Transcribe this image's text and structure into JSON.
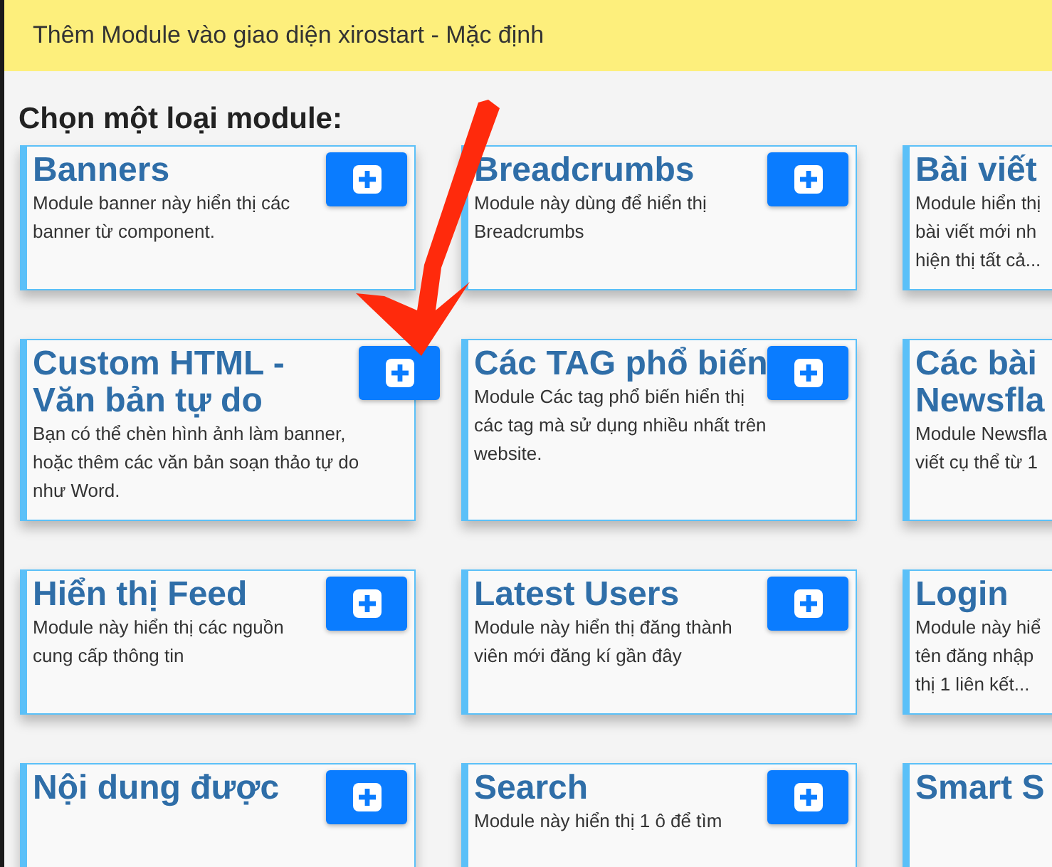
{
  "window": {
    "title": "Thêm Module vào giao diện xirostart - Mặc định"
  },
  "heading": "Chọn một loại module:",
  "modules": [
    {
      "title": [
        "Banners"
      ],
      "description": [
        "Module banner này hiển thị các",
        "banner từ component."
      ]
    },
    {
      "title": [
        "Breadcrumbs"
      ],
      "description": [
        "Module này dùng để hiển thị",
        "Breadcrumbs"
      ]
    },
    {
      "title": [
        "Bài viết"
      ],
      "description": [
        "Module hiển thị",
        "bài viết mới nh",
        "hiện thị tất cả..."
      ]
    },
    {
      "title": [
        "Custom HTML -",
        "Văn bản tự do"
      ],
      "description": [
        "Bạn có thể chèn hình ảnh làm banner,",
        "hoặc thêm các văn bản soạn thảo tự do",
        "như Word."
      ]
    },
    {
      "title": [
        "Các TAG phổ biến"
      ],
      "description": [
        "Module Các tag phổ biến hiển thị",
        "các tag mà sử dụng nhiều nhất trên",
        "website."
      ]
    },
    {
      "title": [
        "Các bài",
        "Newsfla"
      ],
      "description": [
        "Module Newsfla",
        "viết cụ thể từ 1"
      ]
    },
    {
      "title": [
        "Hiển thị Feed"
      ],
      "description": [
        "Module này hiển thị các nguồn",
        "cung cấp thông tin"
      ]
    },
    {
      "title": [
        "Latest Users"
      ],
      "description": [
        "Module này hiển thị đăng thành",
        "viên mới đăng kí gần đây"
      ]
    },
    {
      "title": [
        "Login"
      ],
      "description": [
        "Module này hiể",
        "tên đăng nhập",
        "thị 1 liên kết..."
      ]
    },
    {
      "title": [
        "Nội dung được"
      ]
    },
    {
      "title": [
        "Search"
      ],
      "description": [
        "Module này hiển thị 1 ô để tìm"
      ]
    },
    {
      "title": [
        "Smart S"
      ]
    }
  ]
}
